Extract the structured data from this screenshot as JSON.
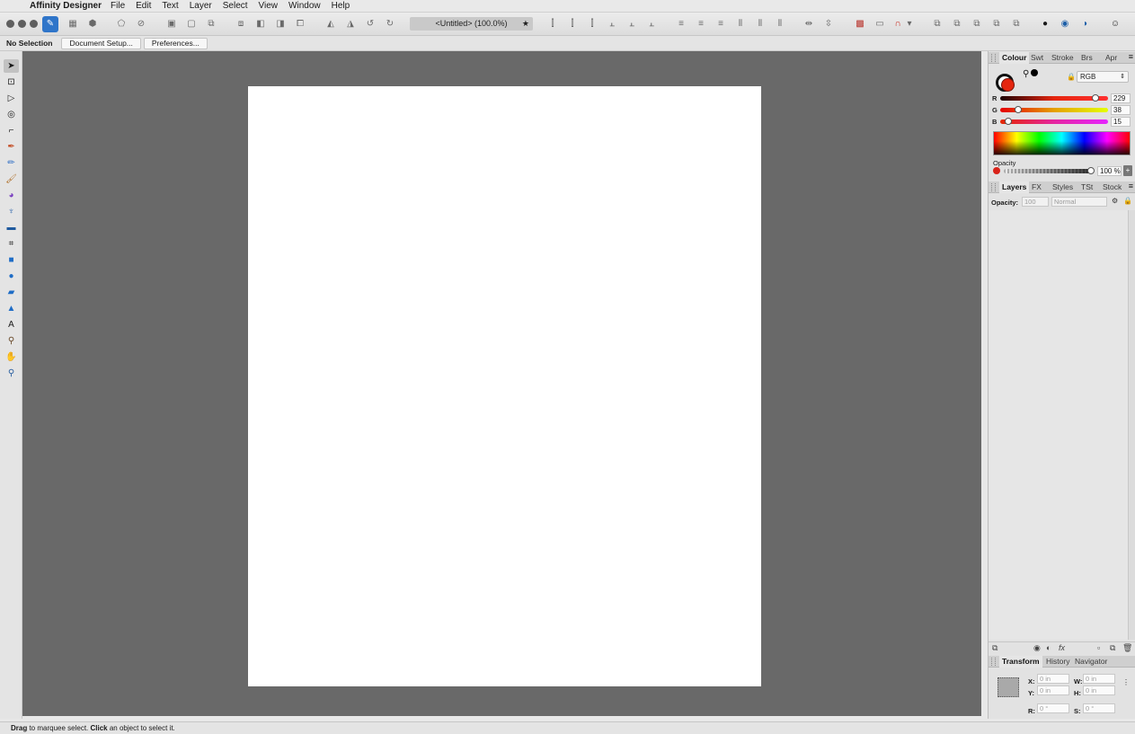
{
  "menubar": {
    "app_name": "Affinity Designer",
    "items": [
      "File",
      "Edit",
      "Text",
      "Layer",
      "Select",
      "View",
      "Window",
      "Help"
    ]
  },
  "toolbar": {
    "document_title": "<Untitled> (100.0%)",
    "title_suffix": "★"
  },
  "context_bar": {
    "selection_label": "No Selection",
    "document_setup_label": "Document Setup...",
    "preferences_label": "Preferences..."
  },
  "colour_panel": {
    "tabs": [
      "Colour",
      "Swt",
      "Stroke",
      "Brs",
      "Apr"
    ],
    "active_tab": "Colour",
    "mode": "RGB",
    "channels": [
      {
        "label": "R",
        "value": "229"
      },
      {
        "label": "G",
        "value": "38"
      },
      {
        "label": "B",
        "value": "15"
      }
    ],
    "stroke_color": "#e5260f",
    "opacity_label": "Opacity",
    "opacity_value": "100 %",
    "opacity_stepper": "+"
  },
  "layers_panel": {
    "tabs": [
      "Layers",
      "FX",
      "Styles",
      "TSt",
      "Stock"
    ],
    "active_tab": "Layers",
    "opacity_label": "Opacity:",
    "opacity_value": "100",
    "blend_mode": "Normal"
  },
  "transform_panel": {
    "tabs": [
      "Transform",
      "History",
      "Navigator"
    ],
    "active_tab": "Transform",
    "fields": {
      "x_label": "X:",
      "x_value": "0 in",
      "y_label": "Y:",
      "y_value": "0 in",
      "w_label": "W:",
      "w_value": "0 in",
      "h_label": "H:",
      "h_value": "0 in",
      "r_label": "R:",
      "r_value": "0 °",
      "s_label": "S:",
      "s_value": "0 °"
    }
  },
  "status_bar": {
    "drag_word": "Drag",
    "drag_text": " to marquee select. ",
    "click_word": "Click",
    "click_text": " an object to select it."
  },
  "icons": {
    "apple": "",
    "tools": [
      "move",
      "artboard",
      "node",
      "point-transform",
      "corner",
      "pen",
      "pencil",
      "vector-brush",
      "fill",
      "transparency",
      "place-image",
      "crop",
      "rectangle",
      "ellipse",
      "rounded-rectangle",
      "triangle",
      "artistic-text",
      "color-picker",
      "hand",
      "zoom"
    ]
  }
}
